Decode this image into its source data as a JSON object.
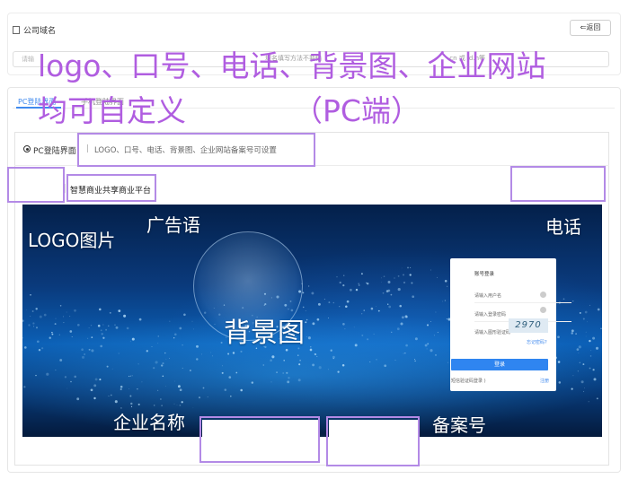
{
  "domain": {
    "title": "公司域名",
    "back_label": "⇐返回",
    "input_placeholder": "请输",
    "hint": "域名填写方法不要输",
    "hint2": ".cn 或 jd.n",
    "hint3": "等"
  },
  "tabs": [
    {
      "label": "PC登陆界面"
    },
    {
      "label": "手机登陆界面"
    }
  ],
  "login_section": {
    "radio_label": "PC登陆界面",
    "separator": "|",
    "description": "LOGO、口号、电话、背景图、企业网站备案号可设置",
    "site_name": "智慧商业共享商业平台"
  },
  "banner": {
    "logo_label": "LOGO图片",
    "slogan_label": "广告语",
    "phone_label": "电话",
    "background_label": "背景图",
    "company_label": "企业名称",
    "icp_label": "备案号"
  },
  "login_box": {
    "title": "账号登录",
    "username_placeholder": "请输入用户名",
    "password_placeholder": "请输入登录密码",
    "captcha_placeholder": "请输入图形验证码",
    "captcha_value": "2970",
    "forgot": "忘记密码?",
    "submit": "登录",
    "sms_login": "短信验证码登录 )",
    "register": "注册"
  },
  "annotation": {
    "line1": "logo、口号、电话、背景图、企业网站",
    "line2": "均可自定义",
    "line3": "（PC端）"
  },
  "colors": {
    "annotation": "#b05de0",
    "accent": "#3f89ee",
    "box_border": "#b38ae6"
  }
}
